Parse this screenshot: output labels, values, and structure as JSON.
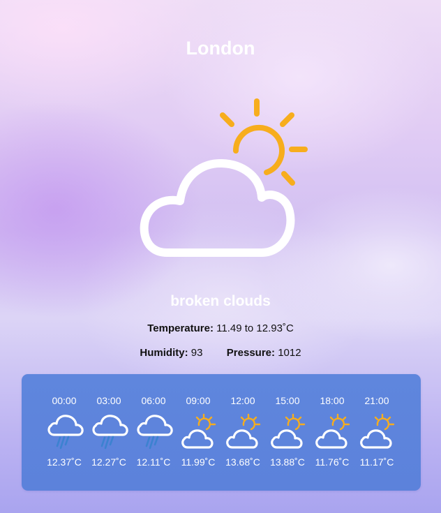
{
  "city": "London",
  "current": {
    "icon": "sun-behind-cloud-icon",
    "description": "broken clouds",
    "temperature_label": "Temperature:",
    "temperature_value": "11.49 to 12.93˚C",
    "humidity_label": "Humidity:",
    "humidity_value": "93",
    "pressure_label": "Pressure:",
    "pressure_value": "1012"
  },
  "forecast": [
    {
      "time": "00:00",
      "icon": "rain-cloud-icon",
      "temp": "12.37˚C"
    },
    {
      "time": "03:00",
      "icon": "rain-cloud-icon",
      "temp": "12.27˚C"
    },
    {
      "time": "06:00",
      "icon": "rain-cloud-icon",
      "temp": "12.11˚C"
    },
    {
      "time": "09:00",
      "icon": "sun-behind-cloud-icon",
      "temp": "11.99˚C"
    },
    {
      "time": "12:00",
      "icon": "sun-behind-cloud-icon",
      "temp": "13.68˚C"
    },
    {
      "time": "15:00",
      "icon": "sun-behind-cloud-icon",
      "temp": "13.88˚C"
    },
    {
      "time": "18:00",
      "icon": "sun-behind-cloud-icon",
      "temp": "11.76˚C"
    },
    {
      "time": "21:00",
      "icon": "sun-behind-cloud-icon",
      "temp": "11.17˚C"
    }
  ],
  "colors": {
    "sun": "#F7AD1D",
    "rain": "#3C82D0",
    "cloud": "#FFFFFF",
    "panel": "#5F86DD"
  }
}
